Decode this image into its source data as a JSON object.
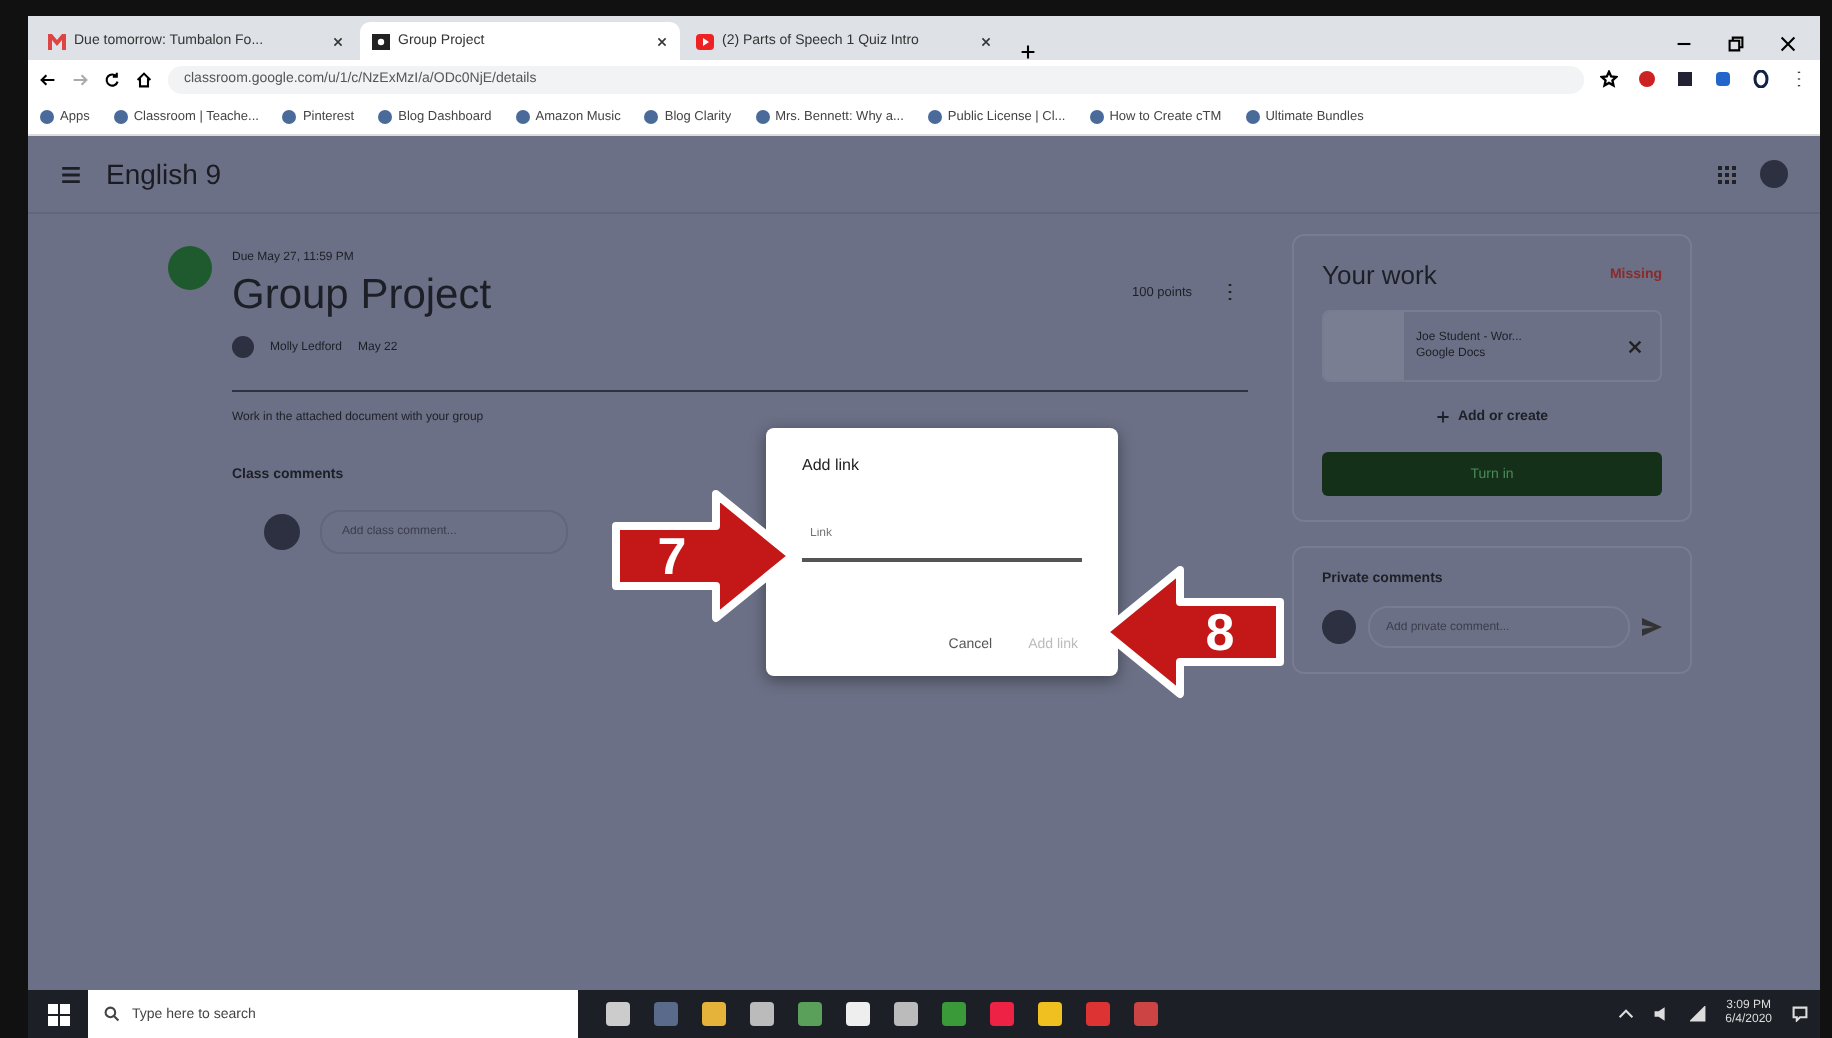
{
  "browser": {
    "tabs": [
      {
        "label": "Due tomorrow: Tumbalon Fo...",
        "kind": "mail",
        "selected": false
      },
      {
        "label": "Group Project",
        "kind": "classroom",
        "selected": true
      },
      {
        "label": "(2) Parts of Speech 1 Quiz Intro",
        "kind": "video",
        "selected": false
      }
    ],
    "url": "classroom.google.com/u/1/c/NzExMzI/a/ODc0NjE/details",
    "bookmarks": [
      {
        "label": "Apps"
      },
      {
        "label": "Classroom | Teache..."
      },
      {
        "label": "Pinterest"
      },
      {
        "label": "Blog Dashboard"
      },
      {
        "label": "Amazon Music"
      },
      {
        "label": "Blog Clarity"
      },
      {
        "label": "Mrs. Bennett: Why a..."
      },
      {
        "label": "Public License | Cl..."
      },
      {
        "label": "How to Create cTM"
      },
      {
        "label": "Ultimate Bundles"
      }
    ]
  },
  "header": {
    "class_name": "English 9"
  },
  "assignment": {
    "due": "Due May 27, 11:59 PM",
    "title": "Group Project",
    "author": "Molly Ledford",
    "posted": "May 22",
    "points": "100 points",
    "instructions": "Work in the attached document with your group",
    "class_comments_label": "Class comments",
    "comment_placeholder": "Add class comment..."
  },
  "your_work": {
    "title": "Your work",
    "status": "Missing",
    "attachment": {
      "name": "Joe Student - Wor...",
      "type": "Google Docs"
    },
    "add_button": "Add or create",
    "turn_in_button": "Turn in"
  },
  "private_comments": {
    "title": "Private comments",
    "placeholder": "Add private comment..."
  },
  "dialog": {
    "title": "Add link",
    "placeholder": "Link",
    "cancel": "Cancel",
    "confirm": "Add link"
  },
  "annotations": [
    {
      "label": "7",
      "kind": "right"
    },
    {
      "label": "8",
      "kind": "left"
    }
  ],
  "taskbar": {
    "search_placeholder": "Type here to search",
    "time": "3:09 PM",
    "date": "6/4/2020"
  }
}
